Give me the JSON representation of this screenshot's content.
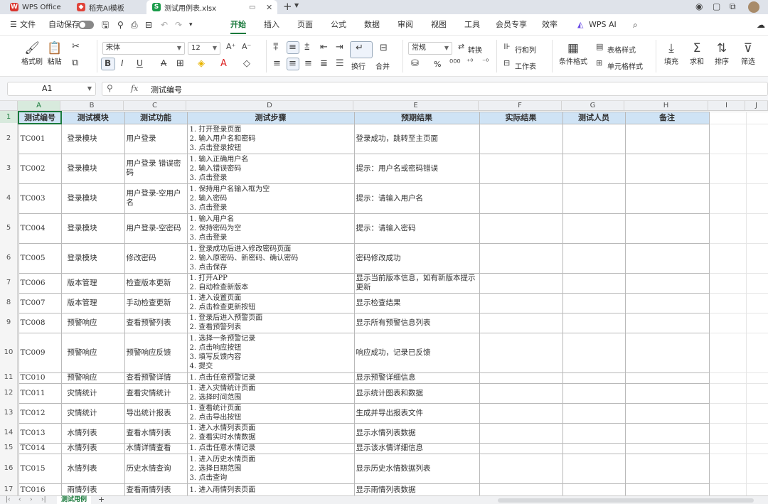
{
  "titlebar": {
    "tabs": [
      {
        "label": "WPS Office",
        "icon": "wps-logo-icon",
        "color": "#d9352e"
      },
      {
        "label": "稻壳AI模板",
        "icon": "docer-logo-icon",
        "color": "#e0433a"
      },
      {
        "label": "测试用例表.xlsx",
        "icon": "spreadsheet-logo-icon",
        "color": "#1a9c4a"
      }
    ],
    "new_tab": "+"
  },
  "menubar": {
    "file": "文件",
    "autosave": "自动保存",
    "items": [
      "开始",
      "插入",
      "页面",
      "公式",
      "数据",
      "审阅",
      "视图",
      "工具",
      "会员专享",
      "效率"
    ],
    "active": "开始",
    "wps_ai": "WPS AI"
  },
  "ribbon": {
    "format_painter": "格式刷",
    "paste": "粘贴",
    "font_name": "宋体",
    "font_size": "12",
    "bold": "B",
    "italic": "I",
    "underline": "U",
    "strike": "A",
    "number_format": "常规",
    "convert": "转换",
    "wrap": "换行",
    "merge": "合并",
    "percent": "%",
    "row_col": "行和列",
    "worksheet": "工作表",
    "cond_format": "条件格式",
    "table_style": "表格样式",
    "cell_style": "单元格样式",
    "fill": "填充",
    "sum": "求和",
    "sort": "排序",
    "filter": "筛选"
  },
  "formula_bar": {
    "cell_ref": "A1",
    "fx": "fx",
    "content": "测试编号"
  },
  "columns": [
    "A",
    "B",
    "C",
    "D",
    "E",
    "F",
    "G",
    "H",
    "I",
    "J"
  ],
  "headers": [
    "测试编号",
    "测试模块",
    "测试功能",
    "测试步骤",
    "预期结果",
    "实际结果",
    "测试人员",
    "备注"
  ],
  "rows": [
    {
      "num": "2",
      "id": "TC001",
      "module": "登录模块",
      "func": "用户登录",
      "steps": [
        "1.  打开登录页面",
        "2.  输入用户名和密码",
        "3.  点击登录按钮"
      ],
      "expected": "登录成功，跳转至主页面"
    },
    {
      "num": "3",
      "id": "TC002",
      "module": "登录模块",
      "func": "用户登录 错误密码",
      "steps": [
        "1.  输入正确用户名",
        "2.  输入错误密码",
        "3.  点击登录"
      ],
      "expected": "提示：用户名或密码错误"
    },
    {
      "num": "4",
      "id": "TC003",
      "module": "登录模块",
      "func": "用户登录-空用户名",
      "steps": [
        "1.  保持用户名输入框为空",
        "2.  输入密码",
        "3.  点击登录"
      ],
      "expected": "提示：请输入用户名"
    },
    {
      "num": "5",
      "id": "TC004",
      "module": "登录模块",
      "func": "用户登录-空密码",
      "steps": [
        "1.  输入用户名",
        "2.  保持密码为空",
        "3.  点击登录"
      ],
      "expected": "提示：请输入密码"
    },
    {
      "num": "6",
      "id": "TC005",
      "module": "登录模块",
      "func": "修改密码",
      "steps": [
        "1.  登录成功后进入修改密码页面",
        "2.  输入原密码、新密码、确认密码",
        "3.  点击保存"
      ],
      "expected": "密码修改成功"
    },
    {
      "num": "7",
      "id": "TC006",
      "module": "版本管理",
      "func": "检查版本更新",
      "steps": [
        "1.  打开APP",
        "2.  自动检查新版本"
      ],
      "expected": "显示当前版本信息，如有新版本提示更新"
    },
    {
      "num": "8",
      "id": "TC007",
      "module": "版本管理",
      "func": "手动检查更新",
      "steps": [
        "1.  进入设置页面",
        "2.  点击检查更新按钮"
      ],
      "expected": "显示检查结果"
    },
    {
      "num": "9",
      "id": "TC008",
      "module": "预警响应",
      "func": "查看预警列表",
      "steps": [
        "1.  登录后进入预警页面",
        "2.  查看预警列表"
      ],
      "expected": "显示所有预警信息列表"
    },
    {
      "num": "10",
      "id": "TC009",
      "module": "预警响应",
      "func": "预警响应反馈",
      "steps": [
        "1.  选择一条预警记录",
        "2.  点击响应按钮",
        "3.  填写反馈内容",
        "4.  提交"
      ],
      "expected": "响应成功，记录已反馈"
    },
    {
      "num": "11",
      "id": "TC010",
      "module": "预警响应",
      "func": "查看预警详情",
      "steps": [
        "1.  点击任意预警记录"
      ],
      "expected": "显示预警详细信息"
    },
    {
      "num": "12",
      "id": "TC011",
      "module": "灾情统计",
      "func": "查看灾情统计",
      "steps": [
        "1.  进入灾情统计页面",
        "2.  选择时间范围"
      ],
      "expected": "显示统计图表和数据"
    },
    {
      "num": "13",
      "id": "TC012",
      "module": "灾情统计",
      "func": "导出统计报表",
      "steps": [
        "1.  查看统计页面",
        "2.  点击导出按钮"
      ],
      "expected": "生成并导出报表文件"
    },
    {
      "num": "14",
      "id": "TC013",
      "module": "水情列表",
      "func": "查看水情列表",
      "steps": [
        "1.  进入水情列表页面",
        "2.  查看实时水情数据"
      ],
      "expected": "显示水情列表数据"
    },
    {
      "num": "15",
      "id": "TC014",
      "module": "水情列表",
      "func": "水情详情查看",
      "steps": [
        "1.  点击任意水情记录"
      ],
      "expected": "显示该水情详细信息"
    },
    {
      "num": "16",
      "id": "TC015",
      "module": "水情列表",
      "func": "历史水情查询",
      "steps": [
        "1.  进入历史水情页面",
        "2.  选择日期范围",
        "3.  点击查询"
      ],
      "expected": "显示历史水情数据列表"
    },
    {
      "num": "17",
      "id": "TC016",
      "module": "雨情列表",
      "func": "查看雨情列表",
      "steps": [
        "1.  进入雨情列表页面"
      ],
      "expected": "显示雨情列表数据"
    }
  ],
  "sheet_tabs": [
    "测试用例"
  ],
  "add_sheet": "+"
}
